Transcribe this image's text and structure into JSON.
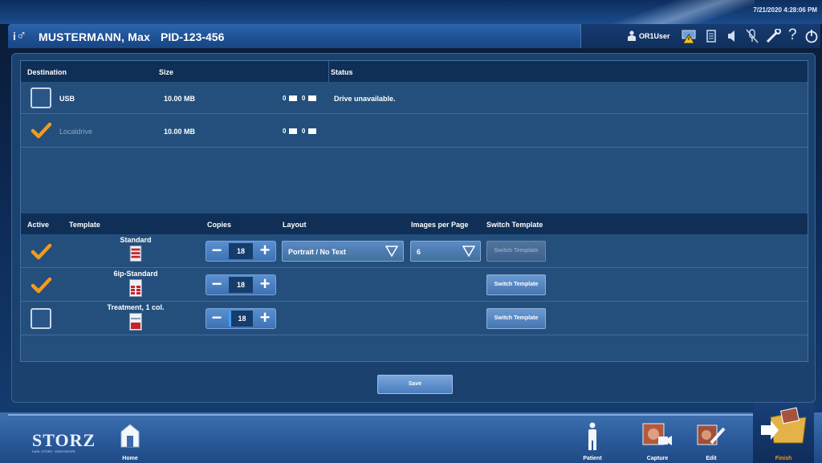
{
  "header": {
    "datetime": "7/21/2020  4:28:06 PM",
    "gender_symbol": "♂",
    "patient_name": "MUSTERMANN, Max",
    "patient_id": "PID-123-456",
    "user": "OR1User",
    "icons": [
      "user-icon",
      "network-warning-icon",
      "storage-icon",
      "volume-icon",
      "mute-icon",
      "tools-icon",
      "help-icon",
      "power-icon"
    ]
  },
  "destinations": {
    "headers": [
      "Destination",
      "Size",
      "Status"
    ],
    "rows": [
      {
        "name": "USB",
        "size": "10.00 MB",
        "images": "0",
        "videos": "0",
        "status": "Drive unavailable.",
        "checked": false,
        "enabled": true
      },
      {
        "name": "Localdrive",
        "size": "10.00 MB",
        "images": "0",
        "videos": "0",
        "status": "",
        "checked": true,
        "enabled": false
      }
    ]
  },
  "templates": {
    "headers": [
      "Active",
      "Template",
      "Copies",
      "Layout",
      "Images per Page",
      "Switch Template"
    ],
    "rows": [
      {
        "active": true,
        "name": "Standard",
        "copies": "18",
        "layout": "Portrait / No Text",
        "images_per_page": "6",
        "switch_label": "Switch Template",
        "switch_enabled": false
      },
      {
        "active": true,
        "name": "6ip-Standard",
        "copies": "18",
        "layout": "",
        "images_per_page": "",
        "switch_label": "Switch Template",
        "switch_enabled": true
      },
      {
        "active": false,
        "name": "Treatment, 1 col.",
        "copies": "18",
        "layout": "",
        "images_per_page": "",
        "switch_label": "Switch Template",
        "switch_enabled": true
      }
    ]
  },
  "save_label": "Save",
  "footer": {
    "logo_main": "STORZ",
    "logo_sub": "KARL STORZ · ENDOSKOPE",
    "nav": {
      "home": "Home",
      "patient": "Patient",
      "capture": "Capture",
      "edit": "Edit",
      "finish": "Finish"
    }
  },
  "colors": {
    "accent": "#f39a1e",
    "panel": "#1b426f",
    "header_row": "#0f2f56"
  }
}
